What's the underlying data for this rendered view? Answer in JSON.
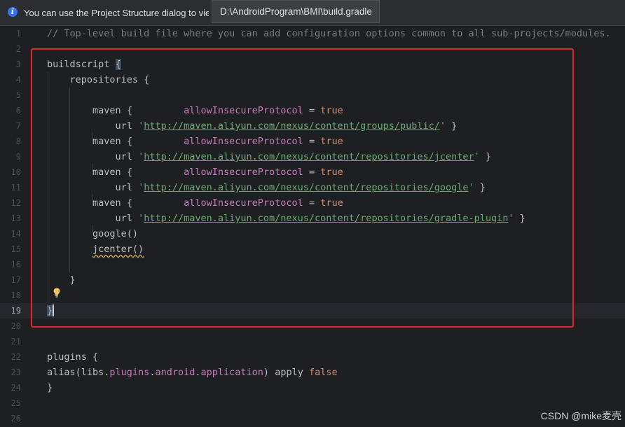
{
  "banner": {
    "icon": "info-icon",
    "text": "You can use the Project Structure dialog to view and edit your project configuration",
    "accent": "#3574f0"
  },
  "tooltip": {
    "path": "D:\\AndroidProgram\\BMI\\build.gradle"
  },
  "editor": {
    "line_numbers": [
      "1",
      "2",
      "3",
      "4",
      "5",
      "6",
      "7",
      "8",
      "9",
      "10",
      "11",
      "12",
      "13",
      "14",
      "15",
      "16",
      "17",
      "18",
      "19",
      "20",
      "21",
      "22",
      "23",
      "24",
      "25",
      "26"
    ],
    "current_line": "19",
    "comment": "// Top-level build file where you can add configuration options common to all sub-projects/modules.",
    "buildscript_kw": "buildscript",
    "repositories_kw": "repositories",
    "maven_kw": "maven",
    "url_kw": "url",
    "insecure_prop": "allowInsecureProtocol",
    "equals": "=",
    "true_kw": "true",
    "false_kw": "false",
    "open_brace": "{",
    "close_brace": "}",
    "quote": "'",
    "urls": [
      "http://maven.aliyun.com/nexus/content/groups/public/",
      "http://maven.aliyun.com/nexus/content/repositories/jcenter",
      "http://maven.aliyun.com/nexus/content/repositories/google",
      "http://maven.aliyun.com/nexus/content/repositories/gradle-plugin"
    ],
    "google_call": "google()",
    "jcenter_call": "jcenter()",
    "plugins_kw": "plugins",
    "alias_open": "alias(libs.",
    "alias_plugins": "plugins",
    "alias_android": "android",
    "alias_application": "application",
    "alias_dot": ".",
    "alias_close": ")",
    "apply_kw": "apply",
    "bulb_icon": "lightbulb-icon"
  },
  "colors": {
    "annotation_box": "#e0262a",
    "keyword": "#cf8e6d",
    "property": "#c77dbb",
    "string": "#6aab73"
  },
  "watermark": "CSDN @mike麦壳"
}
